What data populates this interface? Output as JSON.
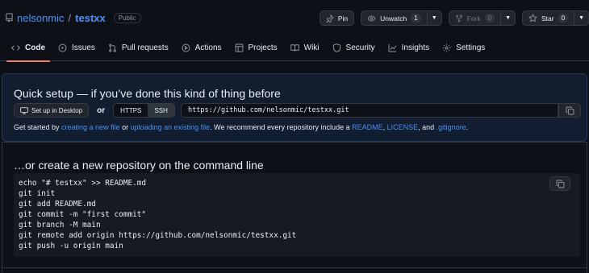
{
  "repo": {
    "owner": "nelsonmic",
    "separator": "/",
    "name": "testxx",
    "visibility": "Public"
  },
  "actions": {
    "pin": "Pin",
    "unwatch": "Unwatch",
    "unwatch_count": "1",
    "fork": "Fork",
    "fork_count": "0",
    "star": "Star",
    "star_count": "0"
  },
  "tabs": [
    {
      "label": "Code",
      "icon": "code-icon",
      "selected": true
    },
    {
      "label": "Issues",
      "icon": "issue-icon"
    },
    {
      "label": "Pull requests",
      "icon": "pull-request-icon"
    },
    {
      "label": "Actions",
      "icon": "play-icon"
    },
    {
      "label": "Projects",
      "icon": "table-icon"
    },
    {
      "label": "Wiki",
      "icon": "book-icon"
    },
    {
      "label": "Security",
      "icon": "shield-icon"
    },
    {
      "label": "Insights",
      "icon": "graph-icon"
    },
    {
      "label": "Settings",
      "icon": "gear-icon"
    }
  ],
  "quick_setup": {
    "title": "Quick setup — if you’ve done this kind of thing before",
    "desktop_button": "Set up in Desktop",
    "or": "or",
    "protocols": [
      "HTTPS",
      "SSH"
    ],
    "active_protocol": "HTTPS",
    "url": "https://github.com/nelsonmic/testxx.git",
    "help": {
      "prefix": "Get started by ",
      "link_new_file": "creating a new file",
      "or": " or ",
      "link_upload": "uploading an existing file",
      "middle": ". We recommend every repository include a ",
      "link_readme": "README",
      "comma": ", ",
      "link_license": "LICENSE",
      "and": ", and ",
      "link_gitignore": ".gitignore",
      "end": "."
    }
  },
  "command_line": {
    "title": "…or create a new repository on the command line",
    "lines": [
      "echo \"# testxx\" >> README.md",
      "git init",
      "git add README.md",
      "git commit -m \"first commit\"",
      "git branch -M main",
      "git remote add origin https://github.com/nelsonmic/testxx.git",
      "git push -u origin main"
    ]
  },
  "colors": {
    "background": "#0d1117",
    "link": "#4493f8",
    "tab_underline": "#f78166",
    "quick_setup_bg": "#121d2f"
  }
}
